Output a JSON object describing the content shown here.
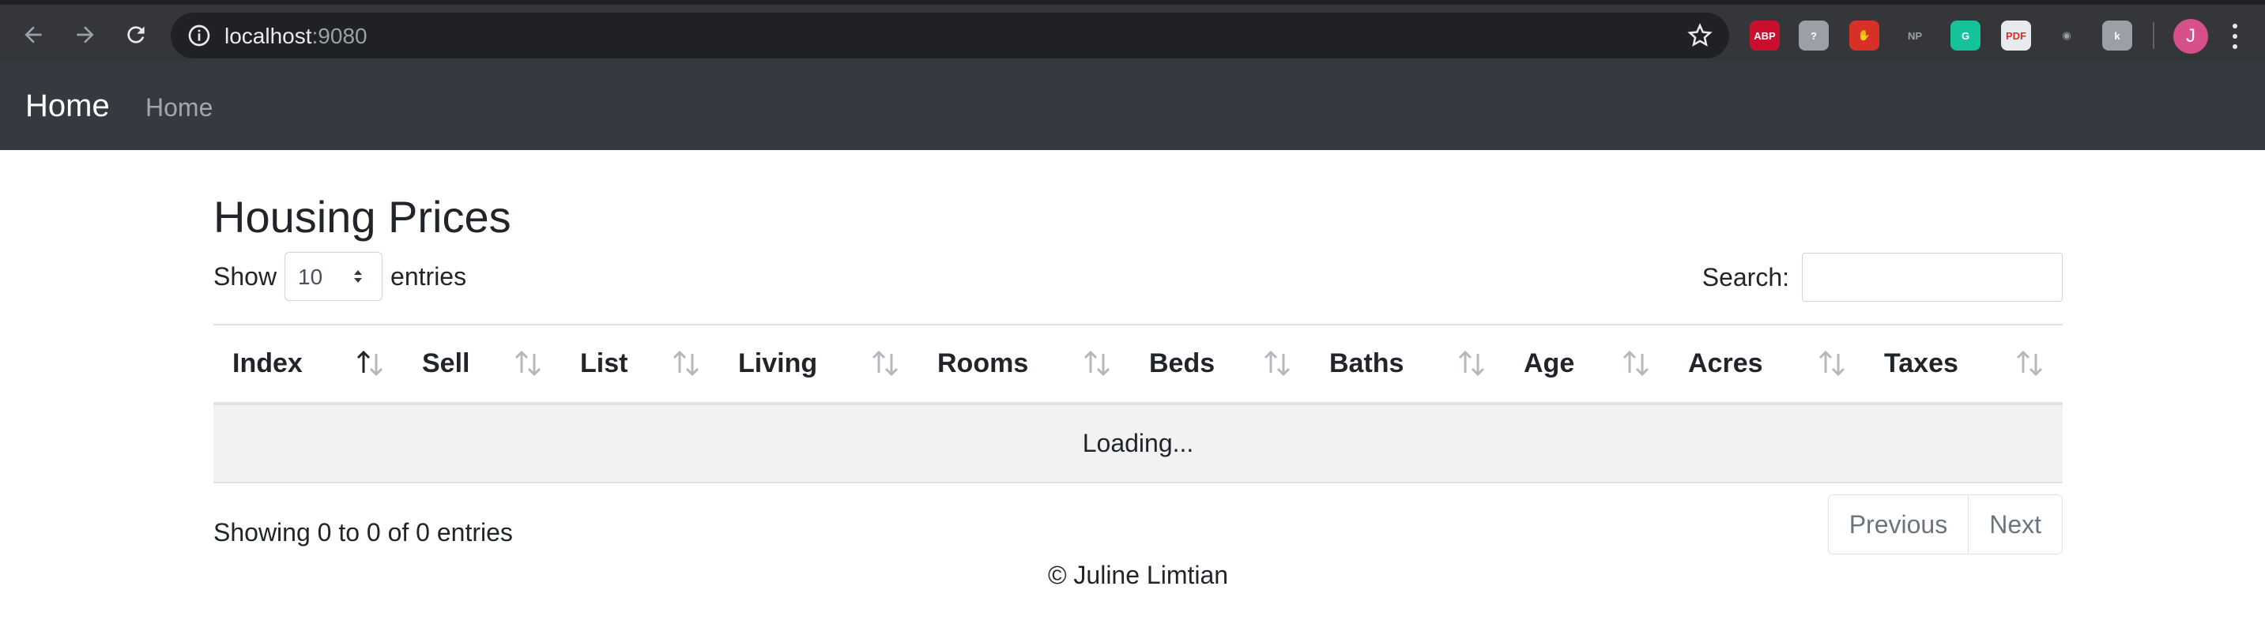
{
  "browser": {
    "url_host": "localhost",
    "url_port": ":9080",
    "extensions": [
      {
        "name": "adblock-plus-icon",
        "label": "ABP",
        "color": "#c8102e"
      },
      {
        "name": "shield-question-icon",
        "label": "?",
        "color": "#9aa0a6"
      },
      {
        "name": "stop-hand-icon",
        "label": "✋",
        "color": "#d93025"
      },
      {
        "name": "np-icon",
        "label": "NP",
        "color": "#35363a"
      },
      {
        "name": "grammarly-icon",
        "label": "G",
        "color": "#15c39a"
      },
      {
        "name": "pdf-icon",
        "label": "PDF",
        "color": "#e8eaed"
      },
      {
        "name": "circle-ext-icon",
        "label": "◉",
        "color": "#35363a"
      },
      {
        "name": "puzzle-ext-icon",
        "label": "k",
        "color": "#9aa0a6"
      }
    ],
    "profile_initial": "J"
  },
  "navbar": {
    "brand": "Home",
    "link": "Home"
  },
  "page": {
    "title": "Housing Prices",
    "show_label": "Show",
    "entries_label": "entries",
    "page_length": "10",
    "search_label": "Search:",
    "columns": [
      "Index",
      "Sell",
      "List",
      "Living",
      "Rooms",
      "Beds",
      "Baths",
      "Age",
      "Acres",
      "Taxes"
    ],
    "loading_text": "Loading...",
    "info_text": "Showing 0 to 0 of 0 entries",
    "previous_label": "Previous",
    "next_label": "Next",
    "footer_text": "© Juline Limtian"
  }
}
